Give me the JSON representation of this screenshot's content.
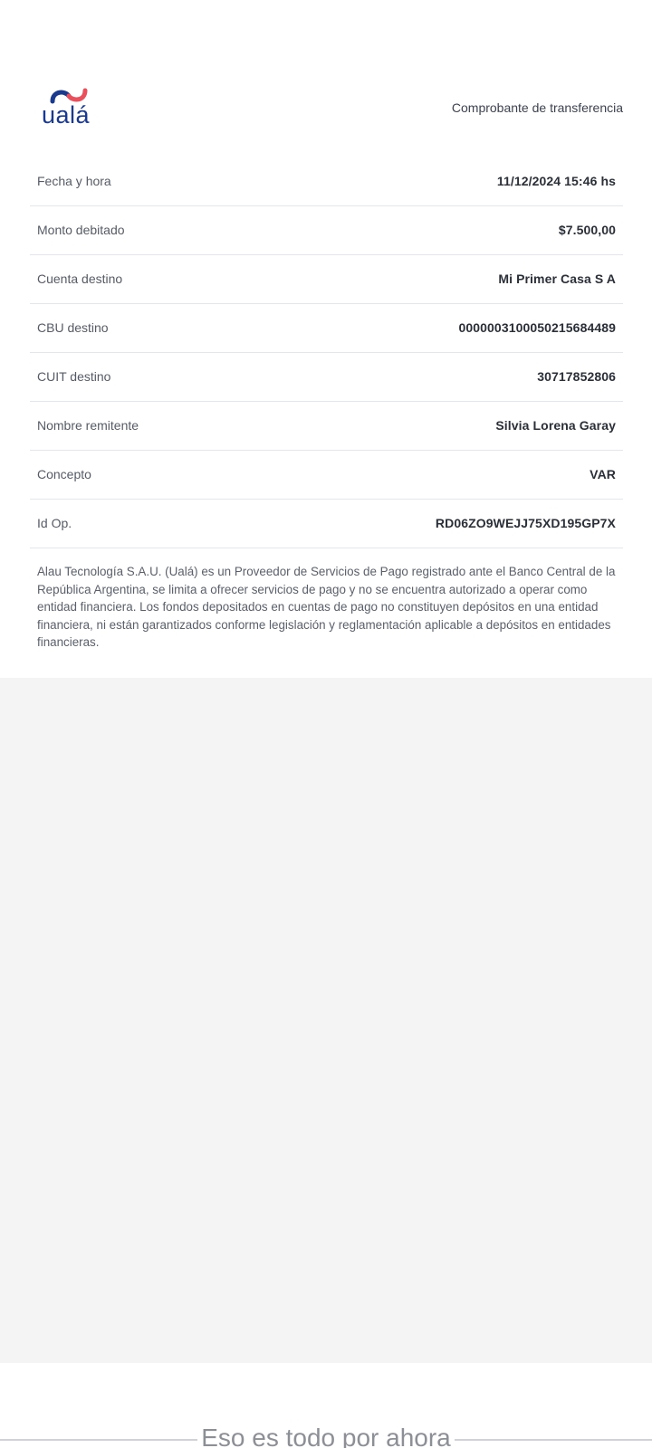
{
  "header": {
    "brand": "ualá",
    "title": "Comprobante de transferencia"
  },
  "details": [
    {
      "label": "Fecha y hora",
      "value": "11/12/2024 15:46 hs"
    },
    {
      "label": "Monto debitado",
      "value": "$7.500,00"
    },
    {
      "label": "Cuenta destino",
      "value": "Mi Primer Casa S A"
    },
    {
      "label": "CBU destino",
      "value": "0000003100050215684489"
    },
    {
      "label": "CUIT destino",
      "value": "30717852806"
    },
    {
      "label": "Nombre remitente",
      "value": "Silvia Lorena Garay"
    },
    {
      "label": "Concepto",
      "value": "VAR"
    },
    {
      "label": "Id Op.",
      "value": "RD06ZO9WEJJ75XD195GP7X"
    }
  ],
  "disclaimer": "Alau Tecnología S.A.U. (Ualá) es un Proveedor de Servicios de Pago registrado ante el Banco Central de la República Argentina, se limita a ofrecer servicios de pago y no se encuentra autorizado a operar como entidad financiera. Los fondos depositados en cuentas de pago no constituyen depósitos en una entidad financiera, ni están garantizados conforme legislación y reglamentación aplicable a depósitos en entidades financieras.",
  "footer": {
    "end_message": "Eso es todo por ahora"
  },
  "colors": {
    "brand_blue": "#1b3a8c",
    "brand_red": "#e8505b",
    "background_gray": "#f4f4f5"
  },
  "icons": {
    "logo": "uala-wave-logo"
  }
}
